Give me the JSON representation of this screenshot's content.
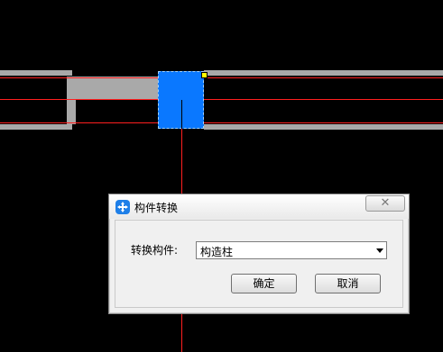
{
  "dialog": {
    "title": "构件转换",
    "close_glyph": "✕",
    "convert_label": "转换构件:",
    "convert_select_value": "构造柱",
    "ok_label": "确定",
    "cancel_label": "取消"
  },
  "icons": {
    "app_icon": "move-arrows-icon",
    "close_icon": "close-icon",
    "dropdown_icon": "chevron-down-icon"
  },
  "colors": {
    "canvas_background": "#000000",
    "wall_fill": "#a9a9a9",
    "axis_line": "#ff1f1f",
    "selected_column": "#0a78ff",
    "grip": "#ffff00"
  }
}
